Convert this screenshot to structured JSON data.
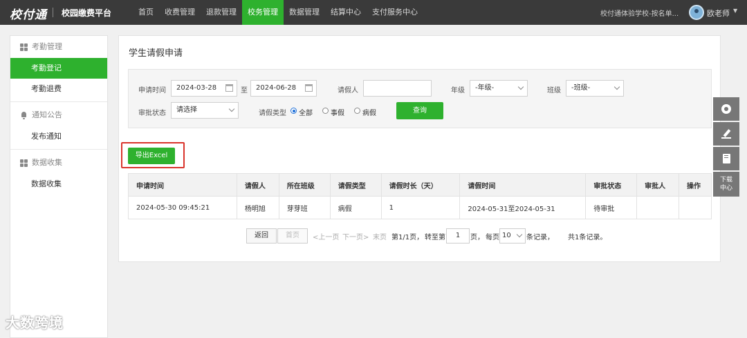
{
  "header": {
    "logo": "校付通",
    "platform": "校园缴费平台",
    "nav": [
      "首页",
      "收费管理",
      "退款管理",
      "校务管理",
      "数据管理",
      "结算中心",
      "支付服务中心"
    ],
    "active_nav": "校务管理",
    "school": "校付通体验学校-按名单...",
    "user": "欧老师"
  },
  "sidebar": {
    "groups": [
      {
        "label": "考勤管理",
        "icon": "grid-icon",
        "items": [
          "考勤登记",
          "考勤退费"
        ]
      },
      {
        "label": "通知公告",
        "icon": "bell-icon",
        "items": [
          "发布通知"
        ]
      },
      {
        "label": "数据收集",
        "icon": "grid-icon",
        "items": [
          "数据收集"
        ]
      }
    ],
    "active_item": "考勤登记"
  },
  "page": {
    "title": "学生请假申请",
    "filters": {
      "apply_time_label": "申请时间",
      "date_from": "2024-03-28",
      "to": "至",
      "date_to": "2024-06-28",
      "leave_person_label": "请假人",
      "leave_person_value": "",
      "grade_label": "年级",
      "grade_value": "-年级-",
      "class_label": "班级",
      "class_value": "-班级-",
      "status_label": "审批状态",
      "status_value": "请选择",
      "type_label": "请假类型",
      "type_options": [
        "全部",
        "事假",
        "病假"
      ],
      "type_selected": "全部",
      "query_button": "查询"
    },
    "export_button": "导出Excel",
    "table": {
      "columns": [
        "申请时间",
        "请假人",
        "所在班级",
        "请假类型",
        "请假时长（天）",
        "请假时间",
        "审批状态",
        "审批人",
        "操作"
      ],
      "rows": [
        [
          "2024-05-30 09:45:21",
          "杨明旭",
          "芽芽班",
          "病假",
          "1",
          "2024-05-31至2024-05-31",
          "待审批",
          "",
          ""
        ]
      ]
    },
    "pagination": {
      "back": "返回",
      "first": "首页",
      "prev": "<上一页",
      "next": "下一页>",
      "last": "末页",
      "page_info": "第1/1页，",
      "goto_prefix": "转至第",
      "goto_value": "1",
      "goto_suffix": "页，",
      "per_page_prefix": "每页",
      "per_page_value": "10",
      "per_page_suffix": "条记录，",
      "total": "共1条记录。"
    }
  },
  "float_tools": {
    "items": [
      "service-icon",
      "edit-icon",
      "book-icon"
    ],
    "download_label_1": "下载",
    "download_label_2": "中心"
  },
  "watermark": "大数跨境",
  "colors": {
    "topbar": "#3a3a3a",
    "accent": "#2eb12e",
    "highlight_border": "#d9332b"
  }
}
